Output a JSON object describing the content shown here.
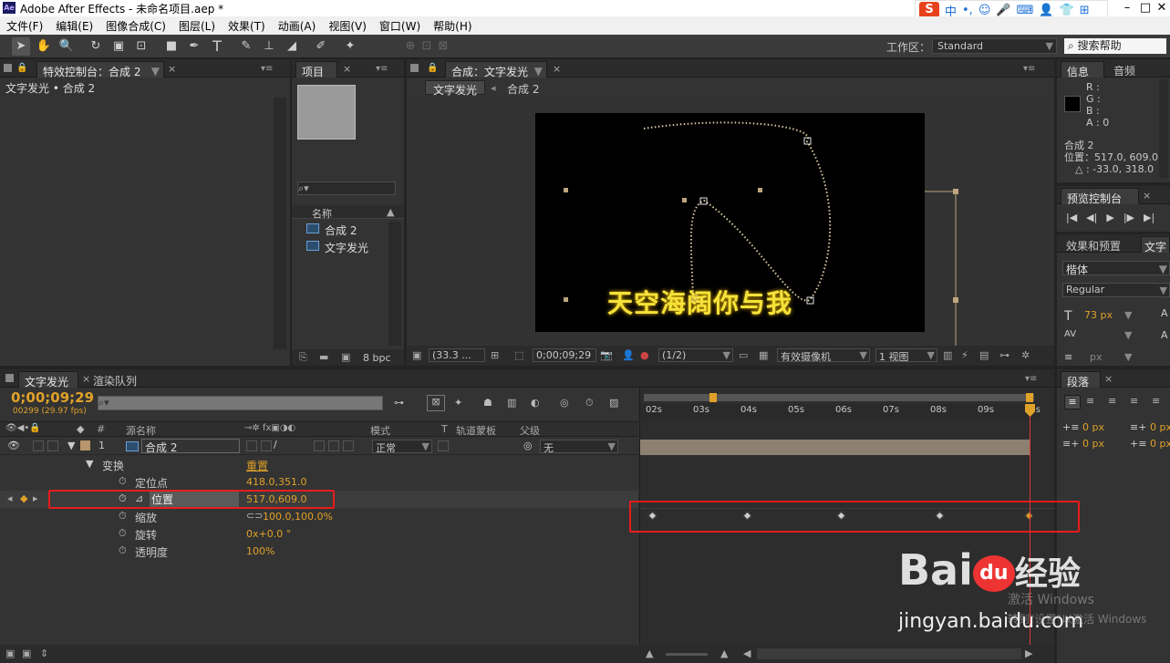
{
  "titlebar": {
    "app_title": "Adobe After Effects - 未命名项目.aep *",
    "logo": "Ae",
    "ime_logo": "S",
    "ime_items": [
      "中",
      "•,",
      "☺",
      "🎤",
      "⌨",
      "👤",
      "👕",
      "⊞"
    ]
  },
  "menu": [
    "文件(F)",
    "编辑(E)",
    "图像合成(C)",
    "图层(L)",
    "效果(T)",
    "动画(A)",
    "视图(V)",
    "窗口(W)",
    "帮助(H)"
  ],
  "toolbar": {
    "workspace_label": "工作区：",
    "workspace_value": "Standard",
    "search_placeholder": "搜索帮助",
    "tools": [
      "selection-arrow",
      "hand",
      "zoom",
      "rotate",
      "camera-orbit",
      "pan-behind",
      "rectangle-mask",
      "pen",
      "text",
      "brush",
      "clone-stamp",
      "eraser",
      "roto-brush",
      "puppet-pin"
    ]
  },
  "effects_panel": {
    "tab_label": "特效控制台：合成 2",
    "breadcrumb": "文字发光 • 合成 2"
  },
  "project_panel": {
    "tab_label": "项目",
    "search_placeholder": "",
    "col_name": "名称",
    "items": [
      "合成 2",
      "文字发光"
    ],
    "bit_depth": "8 bpc"
  },
  "comp_panel": {
    "tab_label": "合成：文字发光",
    "crumb_active": "文字发光",
    "crumb_other": "合成 2",
    "overlay_text": "天空海阔你与我",
    "zoom": "(33.3 ...",
    "timecode": "0;00;09;29",
    "resolution": "(1/2)",
    "camera": "有效摄像机",
    "views": "1 视图"
  },
  "info_panel": {
    "tabs": [
      "信息",
      "音频"
    ],
    "r": "R :",
    "g": "G :",
    "b": "B :",
    "a": "A : 0",
    "layer": "合成 2",
    "position": "位置：517.0, 609.0",
    "delta": "△ : -33.0, 318.0"
  },
  "preview_panel": {
    "tab_label": "预览控制台",
    "buttons": [
      "|◀",
      "◀|",
      "▶",
      "|▶",
      "▶|"
    ]
  },
  "effects_presets": {
    "tab_label": "效果和预置",
    "text_tab": "文字",
    "font": "楷体",
    "style": "Regular",
    "size": "73 px",
    "size_unit": "px"
  },
  "paragraph_panel": {
    "tab_label": "段落",
    "indent_left": "0 px",
    "indent_right": "0 px",
    "space_before": "0 px",
    "space_after": "0 px"
  },
  "timeline": {
    "tab_label": "文字发光",
    "render_tab": "渲染队列",
    "timecode": "0;00;09;29",
    "fps": "00299 (29.97 fps)",
    "search_placeholder": "",
    "col_headers": {
      "source": "源名称",
      "mode": "模式",
      "t": "T",
      "trkmat": "轨道蒙板",
      "parent": "父级",
      "num": "#"
    },
    "layer": {
      "index": "1",
      "name": "合成 2",
      "mode": "正常",
      "parent": "无"
    },
    "group": "变换",
    "reset": "重置",
    "props": [
      {
        "name": "定位点",
        "value": "418.0,351.0"
      },
      {
        "name": "位置",
        "value": "517.0,609.0"
      },
      {
        "name": "缩放",
        "value": "100.0,100.0%"
      },
      {
        "name": "旋转",
        "value": "0x+0.0 °"
      },
      {
        "name": "透明度",
        "value": "100%"
      }
    ],
    "ruler": [
      "02s",
      "03s",
      "04s",
      "05s",
      "06s",
      "07s",
      "08s",
      "09s",
      "10s"
    ]
  },
  "watermark": {
    "brand": "Bai",
    "du": "du",
    "jingyan": "经验",
    "site": "jingyan.baidu.com",
    "win1": "激活 Windows",
    "win2": "转到\"设置\"以激活 Windows"
  },
  "colors": {
    "highlight_box": "#e81c1c",
    "accent": "#e0a128",
    "text_yellow": "#f5e23a"
  }
}
